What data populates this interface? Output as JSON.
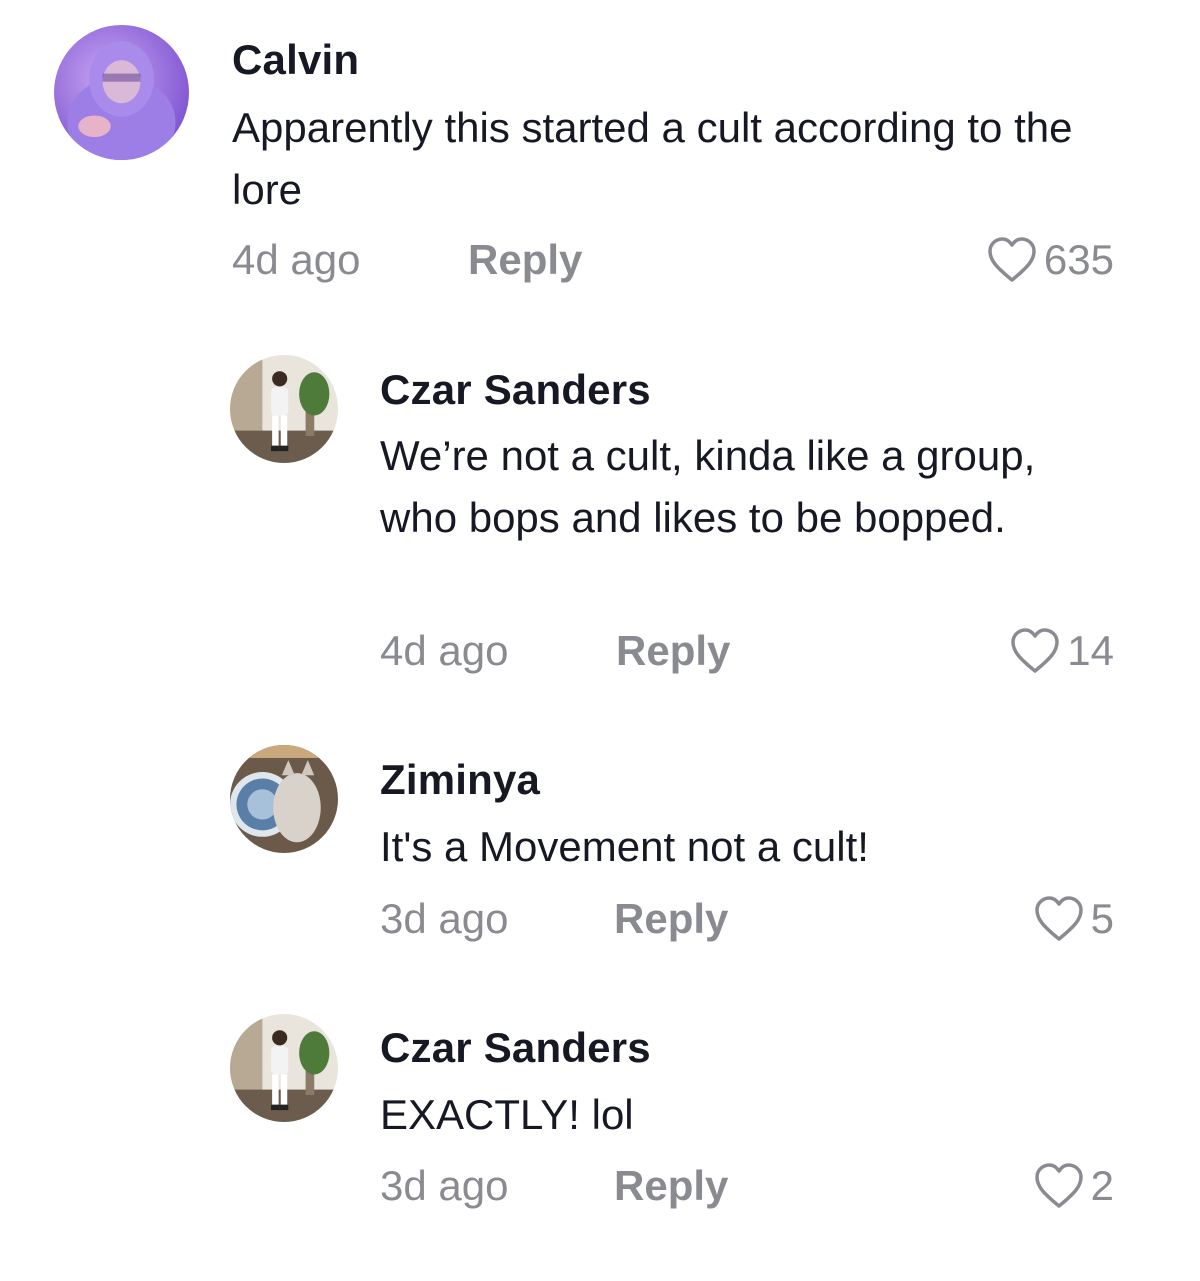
{
  "comments": [
    {
      "username": "Calvin",
      "text": "Apparently this started a cult according to the lore",
      "time": "4d ago",
      "reply_label": "Reply",
      "likes": "635",
      "avatar_icon": "user-avatar-purple-hoodie"
    },
    {
      "username": "Czar Sanders",
      "text": "We’re not a cult, kinda like a group, who bops and likes to be bopped.",
      "time": "4d ago",
      "reply_label": "Reply",
      "likes": "14",
      "avatar_icon": "user-avatar-person-standing"
    },
    {
      "username": "Ziminya",
      "text": "It's a Movement not a cult!",
      "time": "3d ago",
      "reply_label": "Reply",
      "likes": "5",
      "avatar_icon": "user-avatar-cat"
    },
    {
      "username": "Czar Sanders",
      "text": "EXACTLY! lol",
      "time": "3d ago",
      "reply_label": "Reply",
      "likes": "2",
      "avatar_icon": "user-avatar-person-standing"
    }
  ],
  "colors": {
    "text_primary": "#161823",
    "text_secondary": "#8a8b91",
    "background": "#ffffff"
  }
}
